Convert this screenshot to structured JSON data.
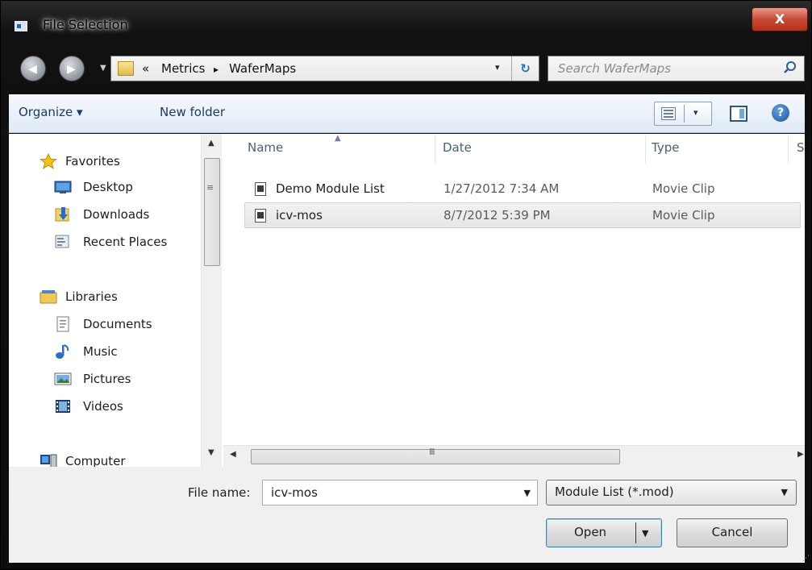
{
  "window": {
    "title": "File Selection",
    "close_label": "X"
  },
  "address_bar": {
    "overflow": "«",
    "crumbs": [
      "Metrics",
      "WaferMaps"
    ],
    "separator": "▸",
    "dropdown_glyph": "▾",
    "refresh_glyph": "↻"
  },
  "search": {
    "placeholder": "Search WaferMaps"
  },
  "toolbar": {
    "organize_label": "Organize ▾",
    "new_folder_label": "New folder",
    "view_dropdown_glyph": "▾",
    "help_glyph": "?"
  },
  "sidebar": {
    "favorites_label": "Favorites",
    "favorites": [
      {
        "label": "Desktop",
        "icon": "desktop-icon"
      },
      {
        "label": "Downloads",
        "icon": "downloads-icon"
      },
      {
        "label": "Recent Places",
        "icon": "recent-places-icon"
      }
    ],
    "libraries_label": "Libraries",
    "libraries": [
      {
        "label": "Documents",
        "icon": "documents-icon"
      },
      {
        "label": "Music",
        "icon": "music-icon"
      },
      {
        "label": "Pictures",
        "icon": "pictures-icon"
      },
      {
        "label": "Videos",
        "icon": "videos-icon"
      }
    ],
    "computer_label": "Computer"
  },
  "file_list": {
    "columns": [
      "Name",
      "Date",
      "Type",
      "S"
    ],
    "rows": [
      {
        "name": "Demo Module List",
        "date": "1/27/2012 7:34 AM",
        "type": "Movie Clip",
        "selected": false
      },
      {
        "name": "icv-mos",
        "date": "8/7/2012 5:39 PM",
        "type": "Movie Clip",
        "selected": true
      }
    ]
  },
  "bottom": {
    "file_name_label": "File name:",
    "file_name_value": "icv-mos",
    "filter_value": "Module List (*.mod)",
    "open_label": "Open",
    "cancel_label": "Cancel"
  },
  "colors": {
    "command_bar": "#dfe9f5",
    "close_button": "#c74a35",
    "selected_row": "#e6e6e6"
  }
}
